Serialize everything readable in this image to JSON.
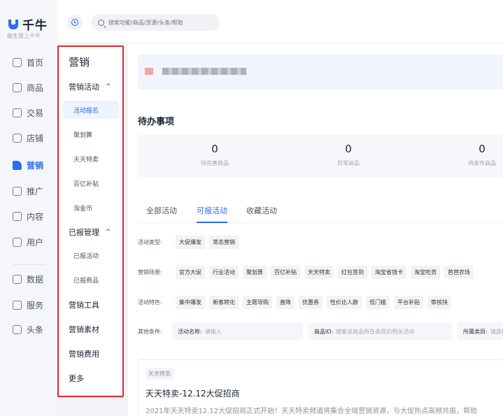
{
  "brand": {
    "name": "千牛",
    "slogan": "做生意上千牛",
    "accent": "#2b6cf6"
  },
  "rail": [
    {
      "label": "首页",
      "icon": "home-icon"
    },
    {
      "label": "商品",
      "icon": "product-icon"
    },
    {
      "label": "交易",
      "icon": "order-icon"
    },
    {
      "label": "店铺",
      "icon": "shop-icon"
    },
    {
      "label": "营销",
      "icon": "flag-icon",
      "active": true
    },
    {
      "label": "推广",
      "icon": "promote-icon"
    },
    {
      "label": "内容",
      "icon": "content-icon"
    },
    {
      "label": "用户",
      "icon": "user-icon"
    },
    {
      "label": "数据",
      "icon": "chart-icon"
    },
    {
      "label": "服务",
      "icon": "service-icon"
    },
    {
      "label": "头条",
      "icon": "news-icon"
    }
  ],
  "topbar": {
    "search_placeholder": "搜索功能/商品/货源/头条/帮助"
  },
  "submenu": {
    "title": "营销",
    "groups": [
      {
        "label": "营销活动",
        "caret": "^"
      },
      {
        "label": "已报管理",
        "caret": "^"
      },
      {
        "label": "营销工具"
      },
      {
        "label": "营销素材"
      },
      {
        "label": "营销费用"
      },
      {
        "label": "更多"
      }
    ],
    "activity_items": [
      "活动报名",
      "聚划算",
      "天天特卖",
      "百亿补贴",
      "淘金币"
    ],
    "reported_items": [
      "已报活动",
      "已报商品"
    ]
  },
  "todo": {
    "title": "待办事项",
    "stats": [
      {
        "value": "0",
        "label": "待完善商品"
      },
      {
        "value": "0",
        "label": "异常商品"
      },
      {
        "value": "0",
        "label": "待发布商品"
      }
    ]
  },
  "tabs": [
    "全部活动",
    "可报活动",
    "收藏活动"
  ],
  "filters": {
    "type": {
      "label": "活动类型:",
      "chips": [
        "大促爆发",
        "常态营销"
      ]
    },
    "scene": {
      "label": "营销场景:",
      "chips": [
        "官方大促",
        "行业活动",
        "聚划算",
        "百亿补贴",
        "天天特卖",
        "红包签到",
        "淘宝省钱卡",
        "淘宝吃货",
        "芭芭农场"
      ]
    },
    "feature": {
      "label": "活动特色:",
      "chips": [
        "集中爆发",
        "新客转化",
        "主题导购",
        "直降",
        "优惠券",
        "性价比人群",
        "低门槛",
        "平台补贴",
        "审核快"
      ]
    },
    "other": {
      "label": "其他条件:",
      "name_key": "活动名称:",
      "name_placeholder": "请输入",
      "id_key": "商品ID:",
      "id_placeholder": "搜索该商品所在类目的相关活动",
      "cat_key": "所属类目:",
      "cat_placeholder": "请选择"
    }
  },
  "card": {
    "tag": "天天特卖",
    "title": "天天特卖-12.12大促招商",
    "desc": "2021年天天特卖12.12大促招商正式开始！天天特卖频道将集合全域营销资源，与大促热点高频共振，帮助"
  }
}
